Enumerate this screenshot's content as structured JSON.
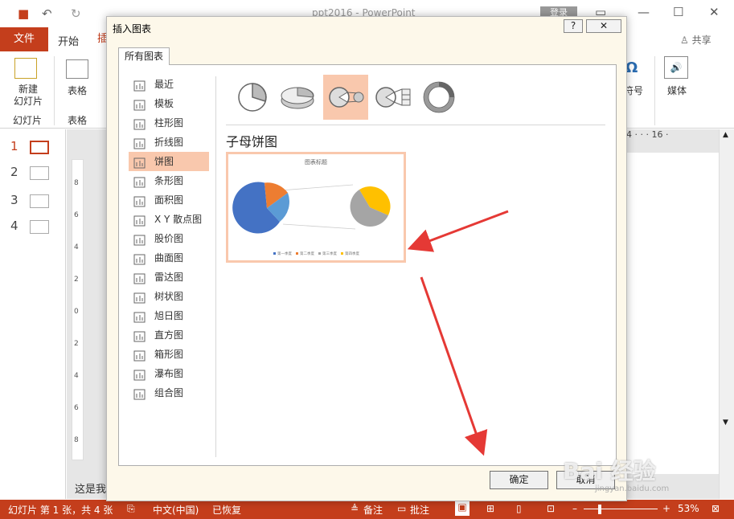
{
  "app": {
    "doc_title": "ppt2016 - PowerPoint",
    "login_label": "登录",
    "share_label": "共享",
    "colors": {
      "accent": "#c43e1c",
      "highlight": "#f9c8ad",
      "arrow": "#e53935"
    }
  },
  "ribbon": {
    "tabs": {
      "file": "文件",
      "home": "开始",
      "insert_partial": "插"
    },
    "groups": {
      "new_slide": "新建\n幻灯片",
      "slides_group": "幻灯片",
      "table": "表格",
      "table_group": "表格",
      "symbol_partial": "符号",
      "symbol_glyph": "Ω",
      "media": "媒体"
    }
  },
  "slides_panel": {
    "items": [
      "1",
      "2",
      "3",
      "4"
    ]
  },
  "ruler": {
    "h_readout": "4 · · · 16 ·",
    "v_ticks": [
      "8",
      "6",
      "4",
      "2",
      "0",
      "2",
      "4",
      "6",
      "8"
    ]
  },
  "notes": {
    "text": "这是我"
  },
  "status": {
    "slide_info": "幻灯片 第 1 张，共 4 张",
    "language": "中文(中国)",
    "recovered": "已恢复",
    "notes": "备注",
    "comments": "批注",
    "zoom": "53%"
  },
  "dialog": {
    "title": "插入图表",
    "help": "?",
    "close": "✕",
    "tab": "所有图表",
    "chart_types": [
      {
        "label": "最近",
        "icon": "recent-icon"
      },
      {
        "label": "模板",
        "icon": "folder-icon"
      },
      {
        "label": "柱形图",
        "icon": "column-chart-icon"
      },
      {
        "label": "折线图",
        "icon": "line-chart-icon"
      },
      {
        "label": "饼图",
        "icon": "pie-chart-icon",
        "active": true
      },
      {
        "label": "条形图",
        "icon": "bar-chart-icon"
      },
      {
        "label": "面积图",
        "icon": "area-chart-icon"
      },
      {
        "label": "X Y 散点图",
        "icon": "scatter-chart-icon"
      },
      {
        "label": "股价图",
        "icon": "stock-chart-icon"
      },
      {
        "label": "曲面图",
        "icon": "surface-chart-icon"
      },
      {
        "label": "雷达图",
        "icon": "radar-chart-icon"
      },
      {
        "label": "树状图",
        "icon": "treemap-chart-icon"
      },
      {
        "label": "旭日图",
        "icon": "sunburst-chart-icon"
      },
      {
        "label": "直方图",
        "icon": "histogram-chart-icon"
      },
      {
        "label": "箱形图",
        "icon": "box-chart-icon"
      },
      {
        "label": "瀑布图",
        "icon": "waterfall-chart-icon"
      },
      {
        "label": "组合图",
        "icon": "combo-chart-icon"
      }
    ],
    "subtypes": [
      "pie-icon",
      "3d-pie-icon",
      "pie-of-pie-icon",
      "bar-of-pie-icon",
      "doughnut-icon"
    ],
    "selected_subtype_name": "子母饼图",
    "preview": {
      "chart_title": "图表标题",
      "legend": [
        "第一季度",
        "第二季度",
        "第三季度",
        "第四季度"
      ]
    },
    "ok": "确定",
    "cancel": "取消"
  },
  "watermark": {
    "main": "Bai 经验",
    "sub": "jingyan.baidu.com"
  }
}
